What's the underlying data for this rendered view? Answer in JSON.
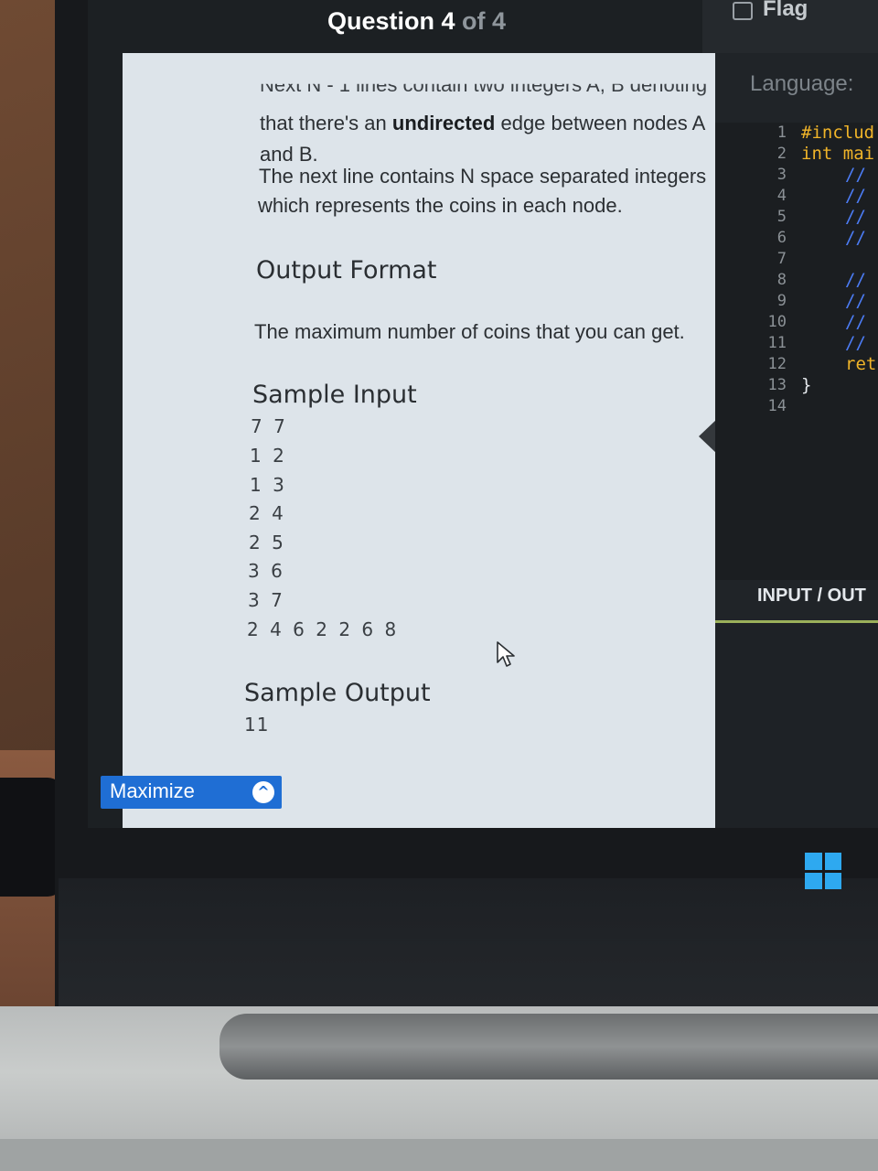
{
  "header": {
    "question_prefix": "Question 4",
    "question_suffix": "of 4",
    "flag_label": "Flag"
  },
  "problem": {
    "cut_line": "Next N - 1 lines contain two integers A, B denoting",
    "line2_pre": "that there's an",
    "line2_bold": "undirected",
    "line2_post": "edge between nodes A",
    "line3": "and B.",
    "line4": "The next line contains N space separated integers",
    "line5": "which represents the coins in each node.",
    "output_heading": "Output Format",
    "output_text": "The maximum number of coins that you can get.",
    "sample_input_heading": "Sample Input",
    "sample_input_lines": [
      "7 7",
      "1 2",
      "1 3",
      "2 4",
      "2 5",
      "3 6",
      "3 7",
      "2 4 6 2 2 6 8"
    ],
    "sample_output_heading": "Sample Output",
    "sample_output_value": "11"
  },
  "maximize": {
    "label": "Maximize"
  },
  "editor": {
    "language_label": "Language:",
    "line_numbers": [
      "1",
      "2",
      "3",
      "4",
      "5",
      "6",
      "7",
      "8",
      "9",
      "10",
      "11",
      "12",
      "13",
      "14"
    ],
    "code_lines": [
      {
        "text": "#includ",
        "kind": "kw",
        "indent": 0
      },
      {
        "text": "int mai",
        "kind": "kw",
        "indent": 0
      },
      {
        "text": "//",
        "kind": "cm",
        "indent": 2
      },
      {
        "text": "//",
        "kind": "cm",
        "indent": 2
      },
      {
        "text": "//",
        "kind": "cm",
        "indent": 2
      },
      {
        "text": "//",
        "kind": "cm",
        "indent": 2
      },
      {
        "text": "",
        "kind": "cm",
        "indent": 2
      },
      {
        "text": "//",
        "kind": "cm",
        "indent": 2
      },
      {
        "text": "//",
        "kind": "cm",
        "indent": 2
      },
      {
        "text": "//",
        "kind": "cm",
        "indent": 2
      },
      {
        "text": "//",
        "kind": "cm",
        "indent": 2
      },
      {
        "text": "ret",
        "kind": "kw",
        "indent": 2
      },
      {
        "text": "}",
        "kind": "rb",
        "indent": 0
      },
      {
        "text": "",
        "kind": "rb",
        "indent": 0
      }
    ],
    "io_label": "INPUT / OUT"
  },
  "colors": {
    "accent_blue": "#1f6ed4",
    "keyword_yellow": "#f0b429",
    "comment_blue": "#4c7cf5",
    "panel_bg": "#dde4ea"
  }
}
